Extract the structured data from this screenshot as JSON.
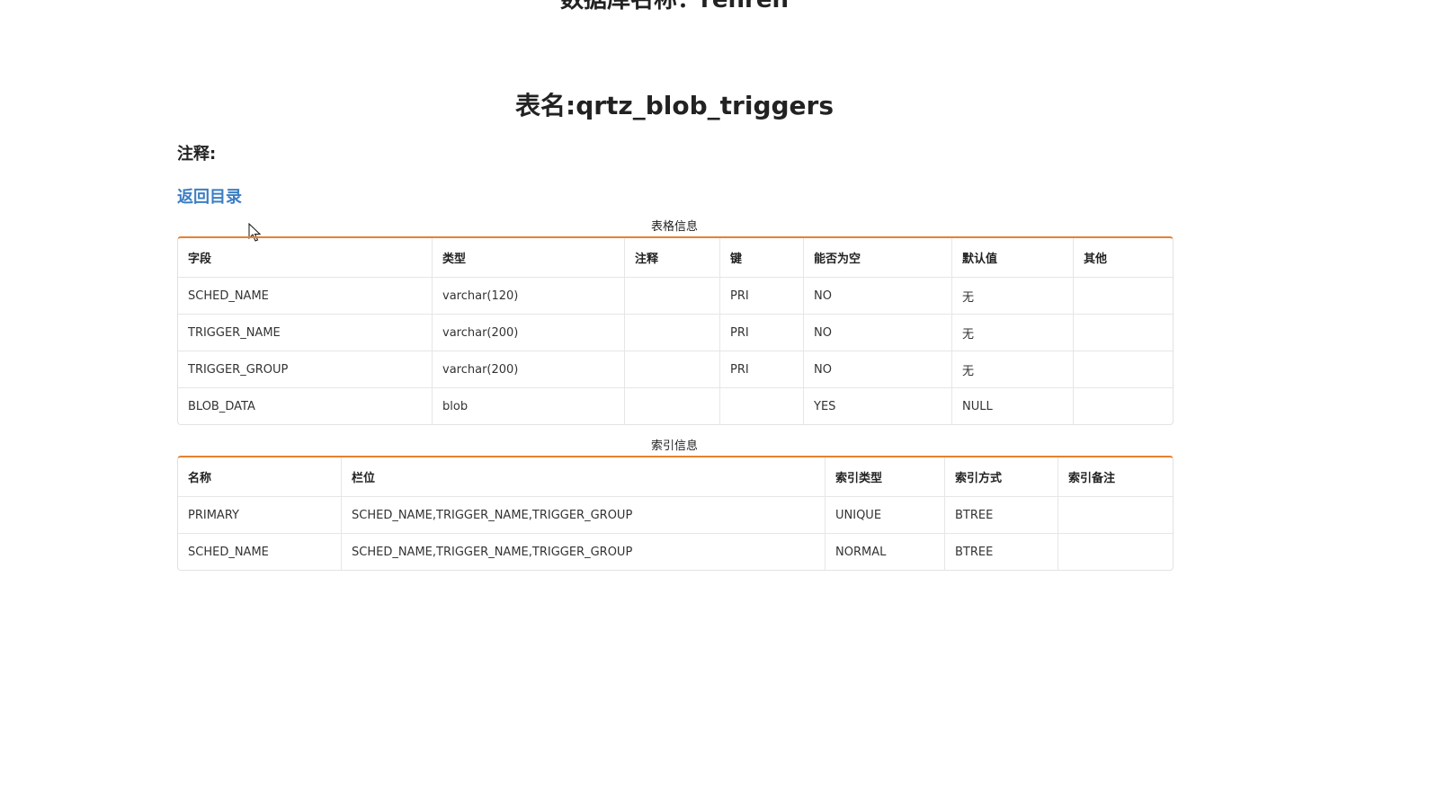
{
  "page": {
    "db_title": "数据库名称：renren",
    "table_title": "表名:qrtz_blob_triggers",
    "comment_label": "注释:",
    "back_link": "返回目录"
  },
  "table_info": {
    "caption": "表格信息",
    "headers": [
      "字段",
      "类型",
      "注释",
      "键",
      "能否为空",
      "默认值",
      "其他"
    ],
    "rows": [
      [
        "SCHED_NAME",
        "varchar(120)",
        "",
        "PRI",
        "NO",
        "无",
        ""
      ],
      [
        "TRIGGER_NAME",
        "varchar(200)",
        "",
        "PRI",
        "NO",
        "无",
        ""
      ],
      [
        "TRIGGER_GROUP",
        "varchar(200)",
        "",
        "PRI",
        "NO",
        "无",
        ""
      ],
      [
        "BLOB_DATA",
        "blob",
        "",
        "",
        "YES",
        "NULL",
        ""
      ]
    ]
  },
  "index_info": {
    "caption": "索引信息",
    "headers": [
      "名称",
      "栏位",
      "索引类型",
      "索引方式",
      "索引备注"
    ],
    "rows": [
      [
        "PRIMARY",
        "SCHED_NAME,TRIGGER_NAME,TRIGGER_GROUP",
        "UNIQUE",
        "BTREE",
        ""
      ],
      [
        "SCHED_NAME",
        "SCHED_NAME,TRIGGER_NAME,TRIGGER_GROUP",
        "NORMAL",
        "BTREE",
        ""
      ]
    ]
  },
  "colors": {
    "accent_border": "#e8802f",
    "link": "#3b7ec4"
  }
}
